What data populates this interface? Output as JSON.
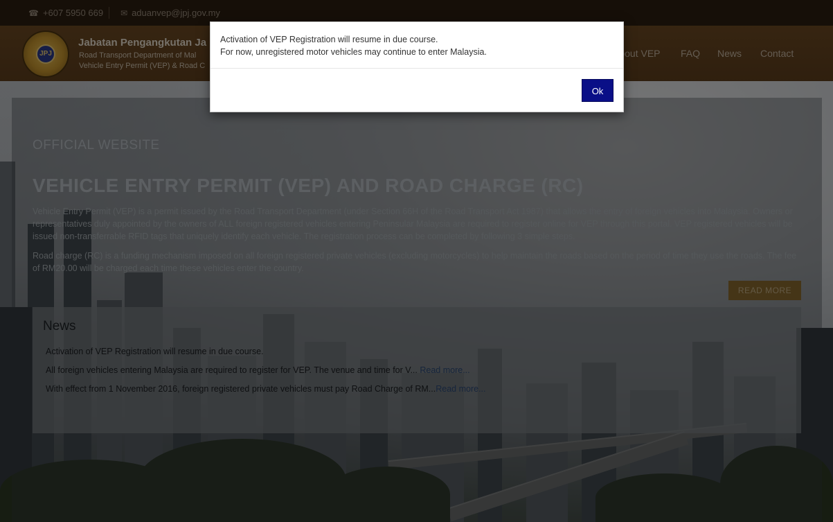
{
  "topbar": {
    "phone": "+607 5950 669",
    "email": "aduanvep@jpj.gov.my",
    "phone_icon": "phone-icon",
    "email_icon": "envelope-icon"
  },
  "header": {
    "logo_text": "JPJ",
    "brand_title": "Jabatan Pengangkutan Ja",
    "brand_sub1": "Road Transport Department of Mal",
    "brand_sub2": "Vehicle Entry Permit (VEP) & Road C",
    "nav": [
      "About VEP",
      "FAQ",
      "News",
      "Contact"
    ]
  },
  "main": {
    "official": "OFFICIAL WEBSITE",
    "heading": "VEHICLE ENTRY PERMIT (VEP) AND ROAD CHARGE (RC)",
    "para1": "Vehicle Entry Permit (VEP) is a permit issued by the Road Transport Department (under Section 66H of the Road Transport Act 1987) that allows the entry of foreign vehicles into Malaysia. Owners or representatives duly appointed by the owners of ALL foreign registered vehicles entering Peninsular Malaysia are required to register online for VEP through this portal. VEP registered vehicles will be issued non-transferrable RFID tags that uniquely identify each vehicle. The registration process can be completed by following 3 simple steps.",
    "para2": "Road charge (RC) is a funding mechanism imposed on all foreign registered private vehicles (excluding motorcycles) to help maintain the roads based on the period of time they use the roads. The fee of RM20.00 will be charged each time these vehicles enter the country.",
    "read_more": "READ MORE"
  },
  "news": {
    "title": "News",
    "items": [
      {
        "text": "Activation of VEP Registration will resume in due course.",
        "link": ""
      },
      {
        "text": "All foreign vehicles entering Malaysia are required to register for VEP. The venue and time for V...",
        "link": "Read more..."
      },
      {
        "text": "With effect from 1 November 2016, foreign registered private vehicles must pay Road Charge of RM...",
        "link": "Read more..."
      }
    ]
  },
  "modal": {
    "line1": "Activation of VEP Registration will resume in due course.",
    "line2": "For now, unregistered motor vehicles may continue to enter Malaysia.",
    "ok_label": "Ok"
  },
  "colors": {
    "ok_button": "#0a0f87",
    "read_more_button": "#8a6a2e",
    "topbar": "#2d1e10",
    "header": "#6d4a23"
  }
}
